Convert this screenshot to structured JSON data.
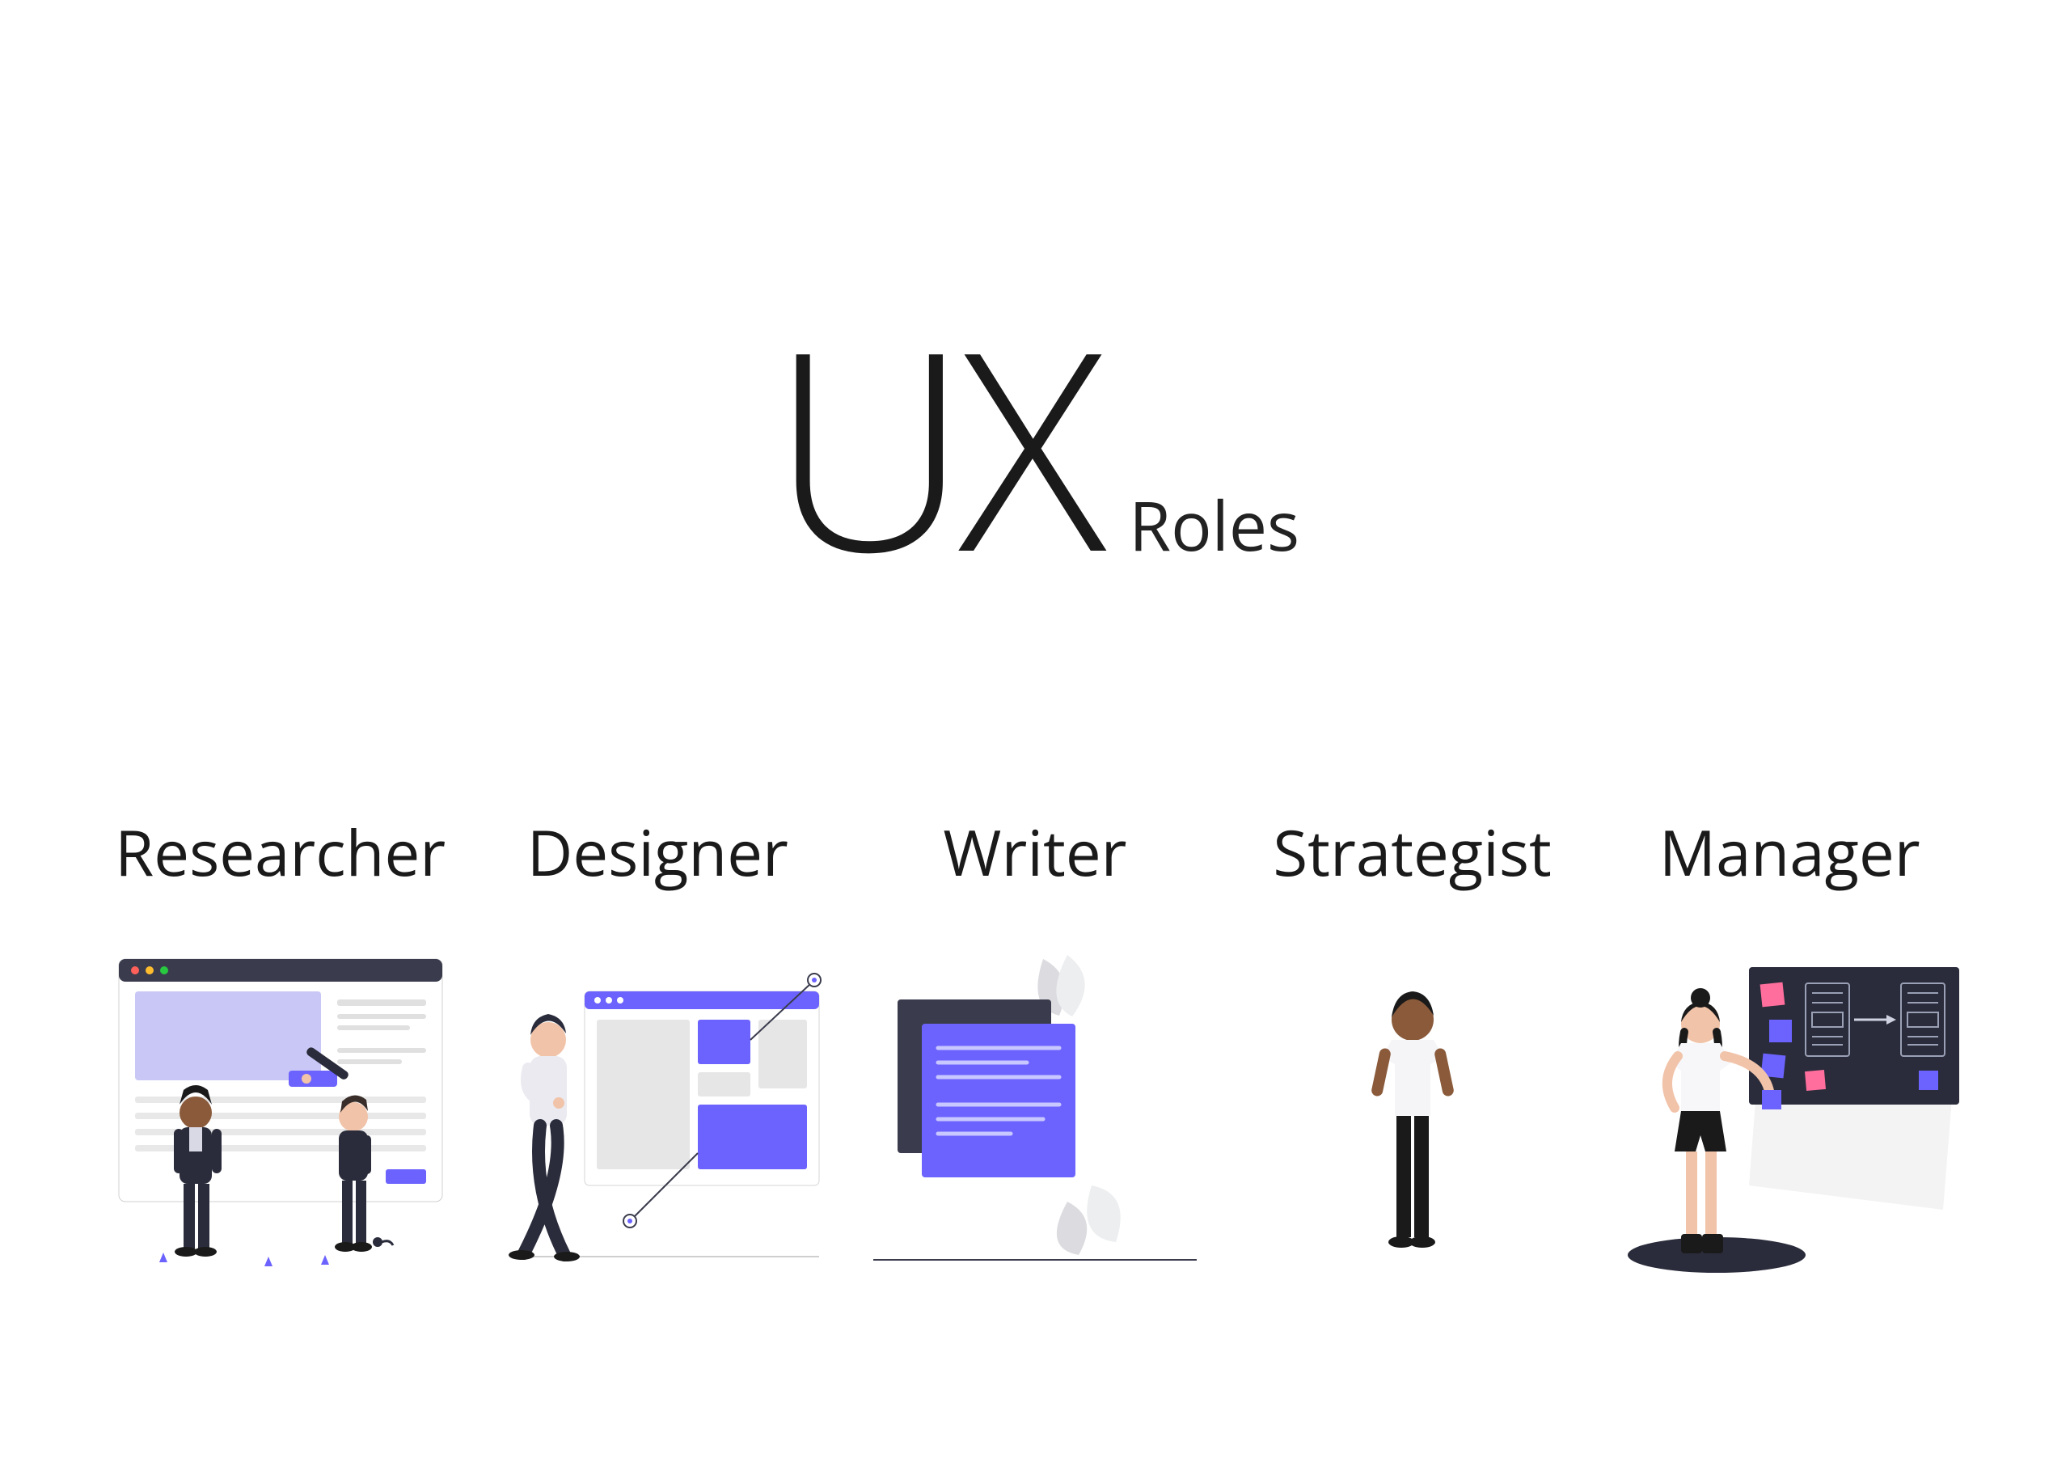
{
  "title": {
    "big": "UX",
    "small": "Roles"
  },
  "roles": [
    {
      "label": "Researcher"
    },
    {
      "label": "Designer"
    },
    {
      "label": "Writer"
    },
    {
      "label": "Strategist"
    },
    {
      "label": "Manager"
    }
  ],
  "colors": {
    "accent": "#6c63ff",
    "dark": "#2a2c3b",
    "grey": "#e6e6e6",
    "skin1": "#a06d4a",
    "skin2": "#f1c3a9",
    "skin3": "#8a5a3a",
    "pink": "#ff6e9c"
  }
}
